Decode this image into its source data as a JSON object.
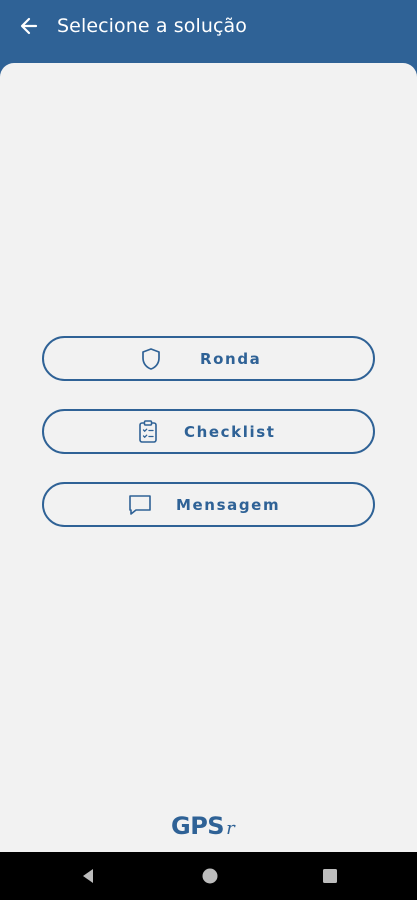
{
  "header": {
    "title": "Selecione a solução",
    "back_icon": "arrow-left-icon"
  },
  "options": [
    {
      "label": "Ronda",
      "icon": "shield-icon"
    },
    {
      "label": "Checklist",
      "icon": "clipboard-checklist-icon"
    },
    {
      "label": "Mensagem",
      "icon": "message-bubble-icon"
    }
  ],
  "footer": {
    "brand_main": "GPS",
    "brand_sub": "r"
  },
  "navigation_bar": {
    "buttons": [
      "back-triangle-icon",
      "home-circle-icon",
      "recents-square-icon"
    ]
  },
  "colors": {
    "primary": "#2f6296",
    "background": "#f2f2f2",
    "nav_bar": "#000000",
    "header_text": "#ffffff"
  }
}
